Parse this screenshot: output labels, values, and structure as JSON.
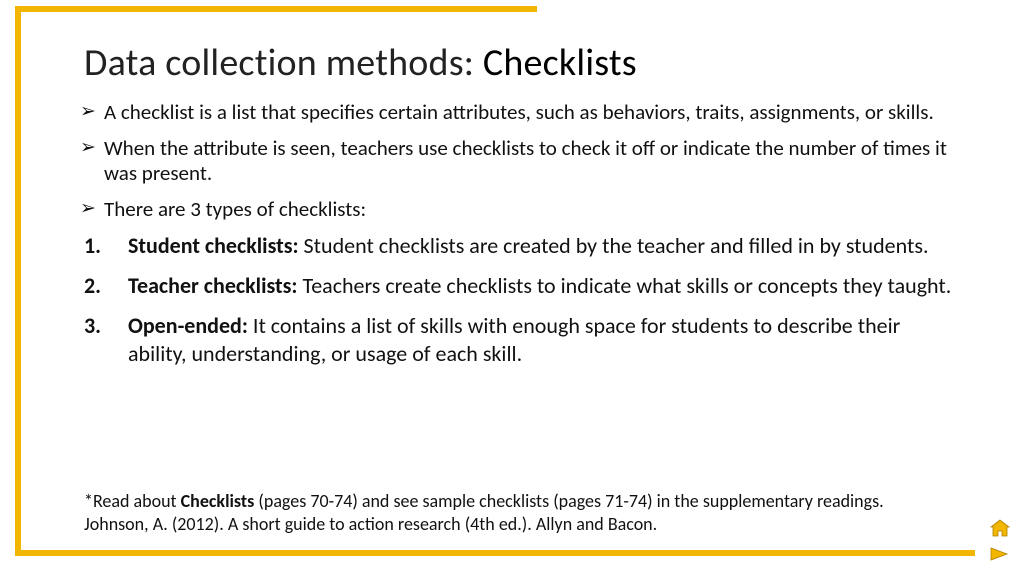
{
  "title": {
    "prefix": "Data collection methods: ",
    "bold": "Checklists"
  },
  "bullets": [
    "A checklist is a list that specifies certain attributes, such as behaviors, traits, assignments, or skills.",
    "When the attribute is seen, teachers use checklists to check it off or indicate the number of times it was present.",
    "There are 3 types of checklists:"
  ],
  "numbered": [
    {
      "num": "1.",
      "label": "Student checklists:",
      "text": " Student checklists are created by the teacher and filled in by students."
    },
    {
      "num": "2.",
      "label": "Teacher checklists:",
      "text": " Teachers create checklists to indicate what skills or concepts they taught."
    },
    {
      "num": "3.",
      "label": "Open-ended:",
      "text": " It contains a list of skills with enough space for students to describe their ability, understanding, or usage of each skill."
    }
  ],
  "footnote": {
    "pre": "*Read about ",
    "bold": "Checklists",
    "post": " (pages 70-74) and see sample checklists (pages 71-74) in the supplementary readings. Johnson, A. (2012). A short guide to action research (4th ed.). Allyn and Bacon."
  },
  "colors": {
    "accent": "#f2b500"
  }
}
